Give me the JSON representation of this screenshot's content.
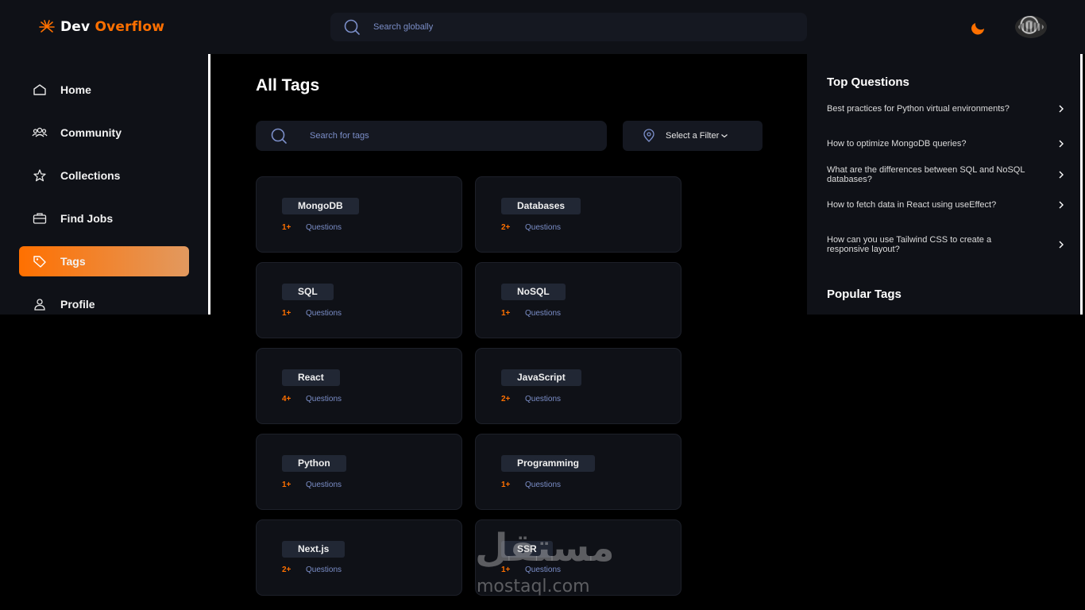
{
  "app": {
    "logo_word1": "Dev",
    "logo_word2": "Overflow",
    "brand_color": "#ff7000"
  },
  "navbar": {
    "search_placeholder": "Search globally",
    "search_icon": "search-icon",
    "theme_icon": "moon-icon",
    "avatar": "user-avatar"
  },
  "sidebar": {
    "items": [
      {
        "label": "Home",
        "icon": "home-icon",
        "active": false
      },
      {
        "label": "Community",
        "icon": "users-icon",
        "active": false
      },
      {
        "label": "Collections",
        "icon": "star-icon",
        "active": false
      },
      {
        "label": "Find Jobs",
        "icon": "briefcase-icon",
        "active": false
      },
      {
        "label": "Tags",
        "icon": "tag-icon",
        "active": true
      },
      {
        "label": "Profile",
        "icon": "user-icon",
        "active": false
      }
    ]
  },
  "main": {
    "title": "All Tags",
    "search_placeholder": "Search for tags",
    "filter_label": "Select a Filter",
    "tags": [
      {
        "name": "MongoDB",
        "count": "1+",
        "label": "Questions"
      },
      {
        "name": "Databases",
        "count": "2+",
        "label": "Questions"
      },
      {
        "name": "SQL",
        "count": "1+",
        "label": "Questions"
      },
      {
        "name": "NoSQL",
        "count": "1+",
        "label": "Questions"
      },
      {
        "name": "React",
        "count": "4+",
        "label": "Questions"
      },
      {
        "name": "JavaScript",
        "count": "2+",
        "label": "Questions"
      },
      {
        "name": "Python",
        "count": "1+",
        "label": "Questions"
      },
      {
        "name": "Programming",
        "count": "1+",
        "label": "Questions"
      },
      {
        "name": "Next.js",
        "count": "2+",
        "label": "Questions"
      },
      {
        "name": "SSR",
        "count": "1+",
        "label": "Questions"
      }
    ]
  },
  "right_sidebar": {
    "top_questions_title": "Top Questions",
    "questions": [
      "Best practices for Python virtual environments?",
      "How to optimize MongoDB queries?",
      "What are the differences between SQL and NoSQL databases?",
      "How to fetch data in React using useEffect?",
      "How can you use Tailwind CSS to create a responsive layout?"
    ],
    "popular_tags_title": "Popular Tags"
  },
  "watermark": {
    "arabic": "مستقل",
    "latin": "mostaql.com"
  }
}
